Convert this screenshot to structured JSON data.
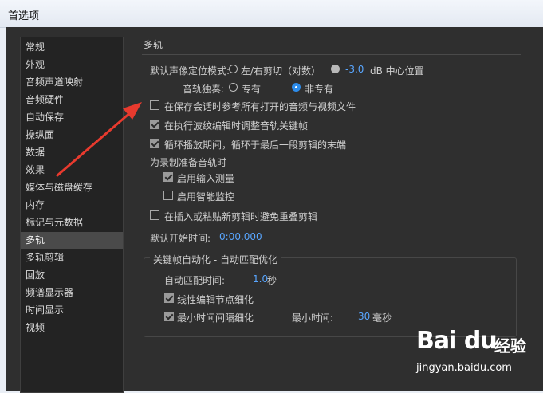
{
  "window": {
    "title": "首选项"
  },
  "sidebar": {
    "items": [
      {
        "label": "常规"
      },
      {
        "label": "外观"
      },
      {
        "label": "音频声道映射"
      },
      {
        "label": "音频硬件"
      },
      {
        "label": "自动保存"
      },
      {
        "label": "操纵面"
      },
      {
        "label": "数据"
      },
      {
        "label": "效果"
      },
      {
        "label": "媒体与磁盘缓存"
      },
      {
        "label": "内存"
      },
      {
        "label": "标记与元数据"
      },
      {
        "label": "多轨"
      },
      {
        "label": "多轨剪辑"
      },
      {
        "label": "回放"
      },
      {
        "label": "频谱显示器"
      },
      {
        "label": "时间显示"
      },
      {
        "label": "视频"
      }
    ],
    "selected": "多轨"
  },
  "panel": {
    "section_title": "多轨",
    "pan_mode": {
      "label": "默认声像定位模式:",
      "option1": "左/右剪切（对数）",
      "value": "-3.0",
      "unit": "dB 中心位置"
    },
    "solo": {
      "label": "音轨独奏:",
      "option1": "专有",
      "option2": "非专有",
      "selected": "非专有"
    },
    "checks": {
      "save_sessions": {
        "label": "在保存会话时参考所有打开的音频与视频文件",
        "checked": false
      },
      "ripple_edit": {
        "label": "在执行波纹编辑时调整音轨关键帧",
        "checked": true
      },
      "loop_playback": {
        "label": "循环播放期间，循环于最后一段剪辑的末端",
        "checked": true
      }
    },
    "record_section": {
      "label": "为录制准备音轨时",
      "enable_input_meter": {
        "label": "启用输入测量",
        "checked": true
      },
      "enable_smart_monitor": {
        "label": "启用智能监控",
        "checked": false
      }
    },
    "avoid_overlap": {
      "label": "在插入或粘贴新剪辑时避免重叠剪辑",
      "checked": false
    },
    "default_start_time": {
      "label": "默认开始时间:",
      "value": "0:00.000"
    },
    "keyframe_group": {
      "title": "关键帧自动化 - 自动匹配优化",
      "auto_match_time": {
        "label": "自动匹配时间:",
        "value": "1.0",
        "unit": "秒"
      },
      "linear_edit": {
        "label": "线性编辑节点细化",
        "checked": true
      },
      "min_interval": {
        "label": "最小时间间隔细化",
        "checked": true
      },
      "min_time": {
        "label": "最小时间:",
        "value": "30",
        "unit": "毫秒"
      }
    }
  },
  "watermark": {
    "logo": "Bai du",
    "cn": "经验",
    "url": "jingyan.baidu.com"
  },
  "colors": {
    "accent_blue": "#59a6ff",
    "radio_selected": "#2d8ceb",
    "annotation_arrow": "#e83a2e"
  }
}
